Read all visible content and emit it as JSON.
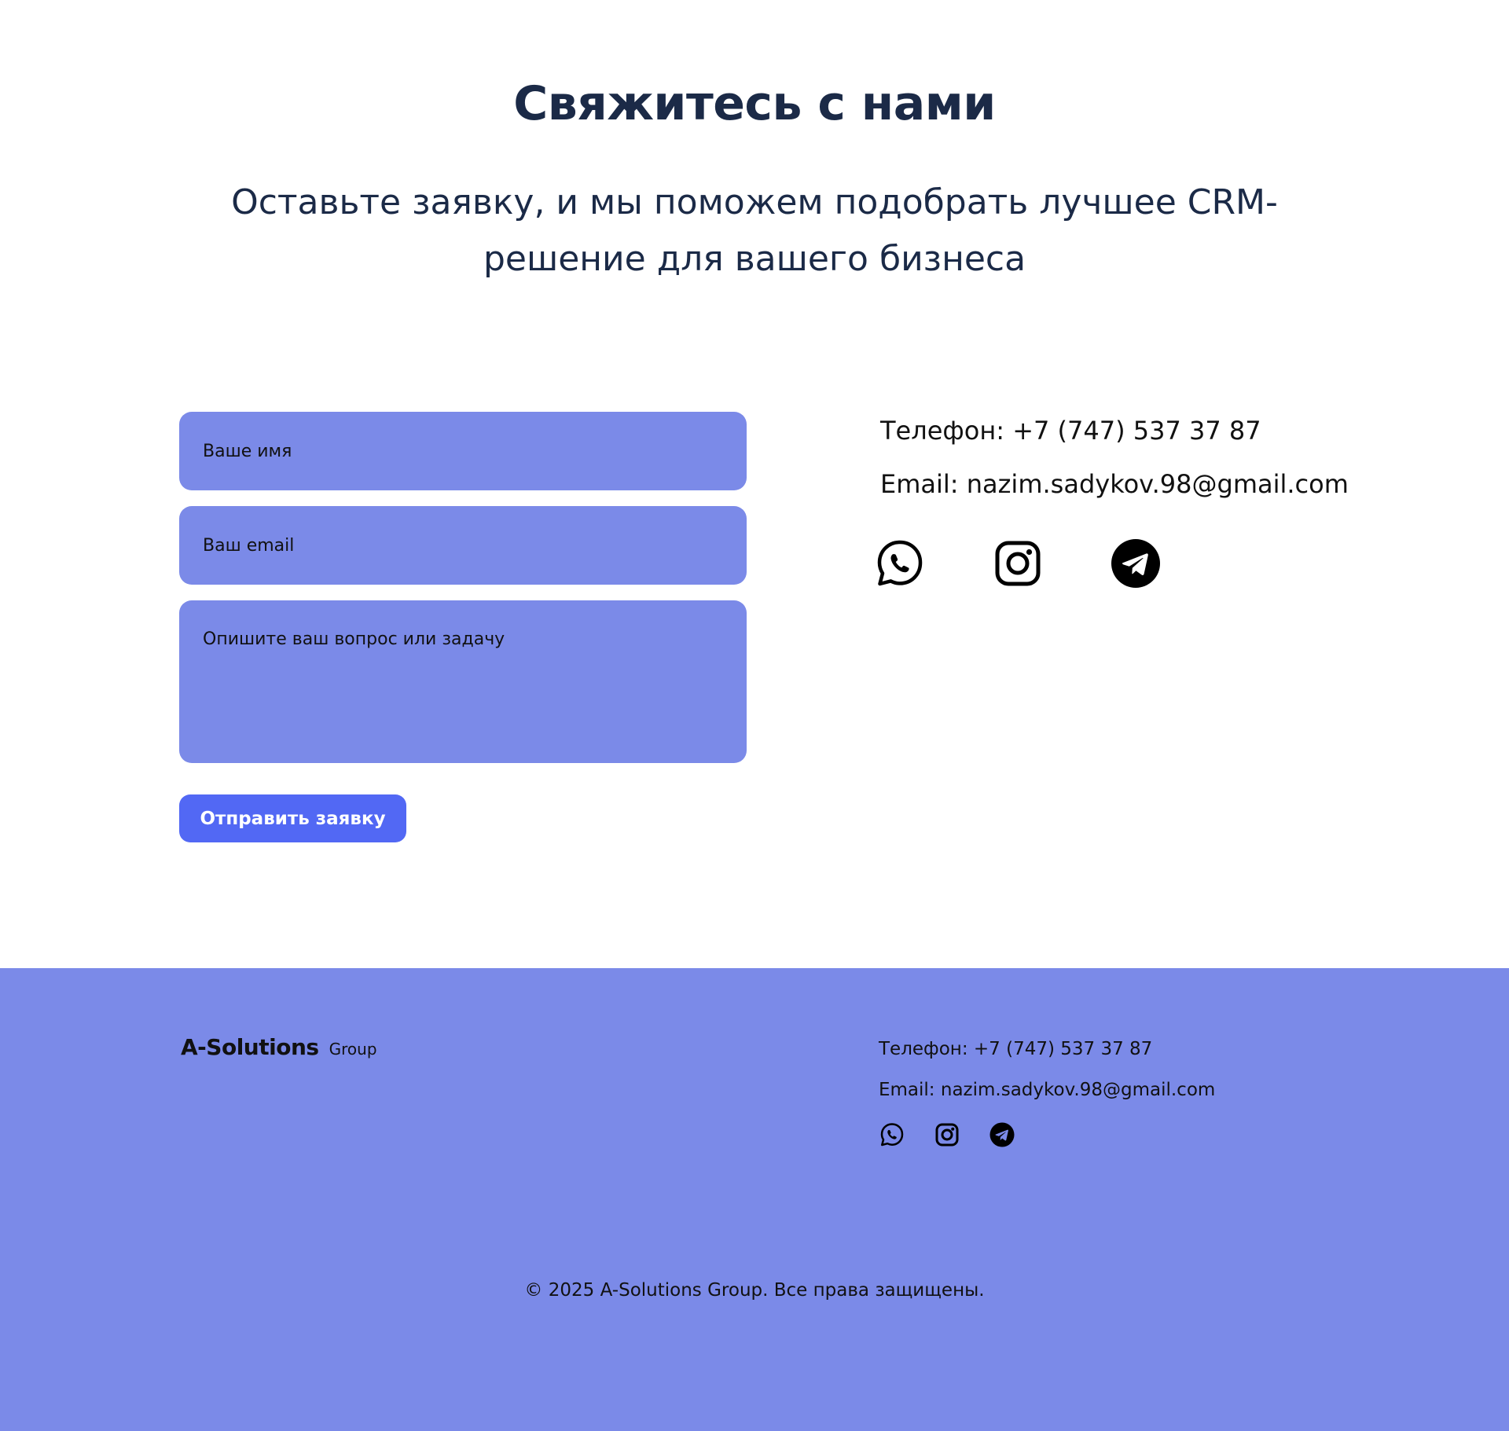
{
  "contact": {
    "title": "Свяжитесь с нами",
    "subtitle": "Оставьте заявку, и мы поможем подобрать лучшее CRM-решение для вашего бизнеса",
    "form": {
      "name_placeholder": "Ваше имя",
      "email_placeholder": "Ваш email",
      "message_placeholder": "Опишите ваш вопрос или задачу",
      "submit_label": "Отправить заявку"
    },
    "info": {
      "phone": "Телефон: +7 (747) 537 37 87",
      "email": "Email: nazim.sadykov.98@gmail.com",
      "socials": [
        "whatsapp-icon",
        "instagram-icon",
        "telegram-icon"
      ]
    }
  },
  "footer": {
    "logo_main": "A-Solutions",
    "logo_sub": "Group",
    "phone": "Телефон: +7 (747) 537 37 87",
    "email": "Email: nazim.sadykov.98@gmail.com",
    "socials": [
      "whatsapp-icon",
      "instagram-icon",
      "telegram-icon"
    ],
    "copyright": "© 2025 A-Solutions Group. Все права защищены."
  },
  "colors": {
    "heading": "#1b2a47",
    "field_bg": "#7b8ae8",
    "button_bg": "#5268f4",
    "footer_bg": "#7b8ae8",
    "text_dark": "#111111"
  }
}
